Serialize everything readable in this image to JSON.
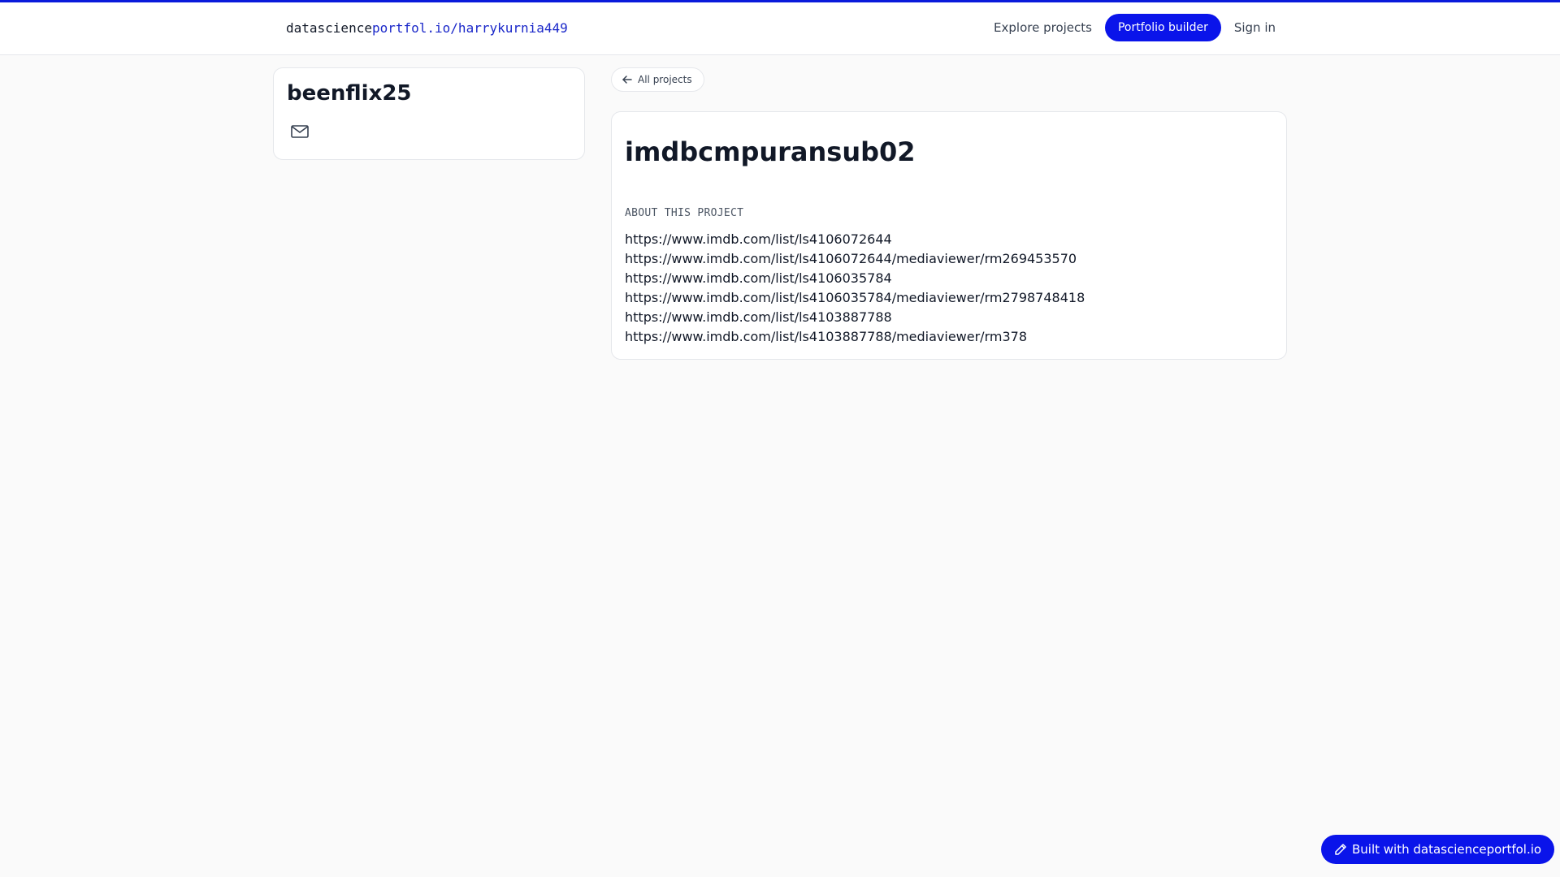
{
  "header": {
    "brand_prefix": "datascience",
    "brand_suffix": "portfol.io/harrykurnia449",
    "nav": {
      "explore": "Explore projects",
      "builder": "Portfolio builder",
      "signin": "Sign in"
    }
  },
  "profile": {
    "name": "beenflix25",
    "contact_icon": "mail-icon"
  },
  "back_button": {
    "label": "All projects",
    "icon": "arrow-left-icon"
  },
  "project": {
    "title": "imdbcmpuransub02",
    "about_label": "ABOUT THIS PROJECT",
    "links": [
      "https://www.imdb.com/list/ls4106072644",
      "https://www.imdb.com/list/ls4106072644/mediaviewer/rm269453570",
      "https://www.imdb.com/list/ls4106035784",
      "https://www.imdb.com/list/ls4106035784/mediaviewer/rm2798748418",
      "https://www.imdb.com/list/ls4103887788",
      "https://www.imdb.com/list/ls4103887788/mediaviewer/rm378"
    ]
  },
  "footer_badge": {
    "label": "Built with datascienceportfol.io",
    "icon": "pencil-icon"
  },
  "colors": {
    "accent": "#0a14ea",
    "brand_link": "#1a27c9",
    "background": "#fafafa"
  }
}
